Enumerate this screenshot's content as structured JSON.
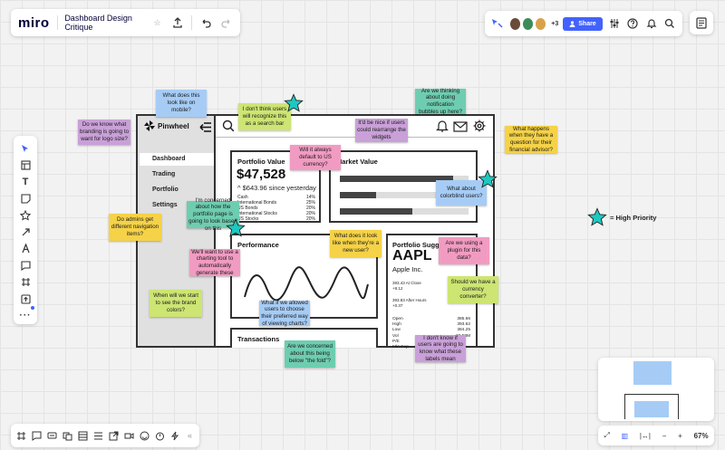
{
  "app": {
    "logo": "miro",
    "board_title": "Dashboard Design Critique"
  },
  "topbar": {
    "extra_collaborators": "+3",
    "share_label": "Share"
  },
  "legend": {
    "label": "= High Priority"
  },
  "zoom": "67%",
  "colors": {
    "yellow": "#f5d247",
    "green": "#cde572",
    "blue": "#a6ccf5",
    "teal": "#6ecdb0",
    "purple": "#c9a0d8",
    "pink": "#f29bc2",
    "star": "#1ec8c0",
    "accent": "#4262ff"
  },
  "wireframe": {
    "brand": "Pinwheel",
    "nav": [
      "Dashboard",
      "Trading",
      "Portfolio",
      "Settings"
    ],
    "portfolio": {
      "title": "Portfolio Value",
      "value": "$47,528",
      "change": "^ $643.96 since yesterday",
      "rows": [
        {
          "label": "Cash",
          "pct": "14%"
        },
        {
          "label": "International Bonds",
          "pct": "25%"
        },
        {
          "label": "US Bonds",
          "pct": "20%"
        },
        {
          "label": "International Stocks",
          "pct": "20%"
        },
        {
          "label": "US Stocks",
          "pct": "20%"
        }
      ]
    },
    "market_title": "Market Value",
    "performance_title": "Performance",
    "suggestion": {
      "title": "Portfolio Suggestion",
      "ticker": "AAPL",
      "company": "Apple Inc.",
      "close": "393.43 At Close",
      "close_change": "+8.12",
      "after": "393.83 After Hours",
      "after_change": "+0.37",
      "stats": [
        {
          "label": "Open",
          "value": "385.66"
        },
        {
          "label": "High",
          "value": "393.62"
        },
        {
          "label": "Low",
          "value": "384.25"
        },
        {
          "label": "Vol",
          "value": "22.58M"
        },
        {
          "label": "P/E",
          "value": ""
        },
        {
          "label": "Mkt Cap",
          "value": ""
        }
      ]
    },
    "transactions_title": "Transactions"
  },
  "stickies": {
    "s1": "What does this look like on mobile?",
    "s2": "I don't think users will recognize this as a search bar",
    "s3": "Are we thinking about doing notification bubbles up here?",
    "s4": "Do we know what branding is going to want for logo size?",
    "s5": "It'd be nice if users could rearrange the widgets",
    "s6": "What happens when they have a question for their financial advisor?",
    "s7": "Will it always default to US currency?",
    "s8": "What about colorblind users?",
    "s9": "I'm concerned about how the portfolio page is going to look based on this",
    "s10": "Do admins get different navigation items?",
    "s11": "What does it look like when they're a new user?",
    "s12": "Are we using a plugin for this data?",
    "s13": "We'll want to use a charting tool to automatically generate these",
    "s14": "Should we have a currency converter?",
    "s15": "When will we start to see the brand colors?",
    "s16": "What if we allowed users to choose their preferred way of viewing charts?",
    "s17": "Are we concerned about this being below \"the fold\"?",
    "s18": "I don't know if users are going to know what these labels mean"
  }
}
